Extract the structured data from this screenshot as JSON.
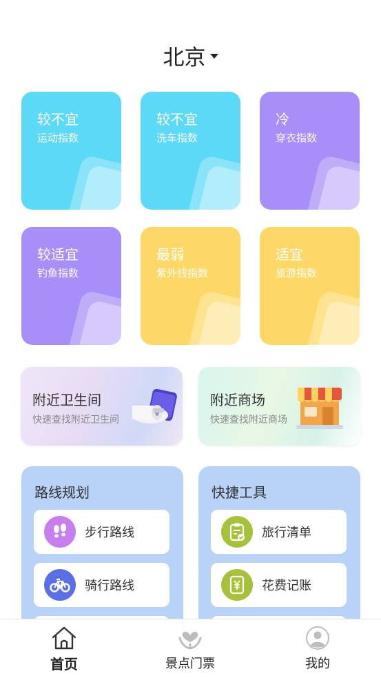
{
  "header": {
    "city": "北京"
  },
  "indices": [
    {
      "value": "较不宜",
      "label": "运动指数"
    },
    {
      "value": "较不宜",
      "label": "洗车指数"
    },
    {
      "value": "冷",
      "label": "穿衣指数"
    },
    {
      "value": "较适宜",
      "label": "钓鱼指数"
    },
    {
      "value": "最弱",
      "label": "紫外线指数"
    },
    {
      "value": "适宜",
      "label": "旅游指数"
    }
  ],
  "promos": {
    "toilet": {
      "title": "附近卫生间",
      "subtitle": "快速查找附近卫生间"
    },
    "mall": {
      "title": "附近商场",
      "subtitle": "快速查找附近商场"
    }
  },
  "route_panel": {
    "title": "路线规划",
    "items": [
      {
        "label": "步行路线",
        "icon": "footprints-icon",
        "color": "#c77ff0"
      },
      {
        "label": "骑行路线",
        "icon": "bicycle-icon",
        "color": "#5a6fe6"
      }
    ]
  },
  "tools_panel": {
    "title": "快捷工具",
    "items": [
      {
        "label": "旅行清单",
        "icon": "clipboard-icon",
        "color": "#a6c23a"
      },
      {
        "label": "花费记账",
        "icon": "yuan-receipt-icon",
        "color": "#a6c23a"
      }
    ]
  },
  "tabbar": {
    "tabs": [
      {
        "label": "首页",
        "icon": "home-icon",
        "active": true
      },
      {
        "label": "景点门票",
        "icon": "scenic-ticket-icon",
        "active": false
      },
      {
        "label": "我的",
        "icon": "profile-icon",
        "active": false
      }
    ]
  }
}
